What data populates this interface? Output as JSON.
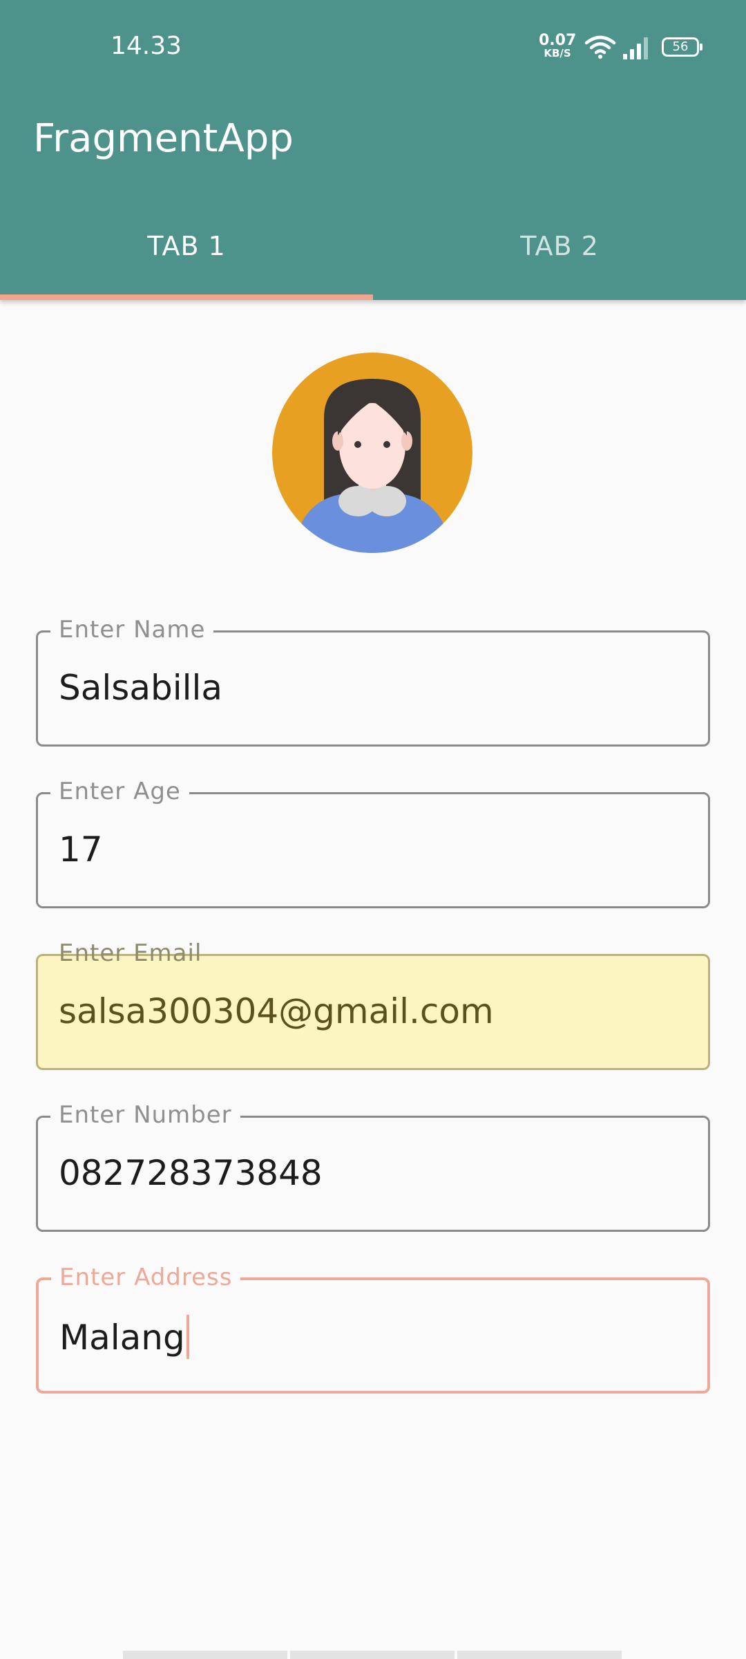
{
  "status_bar": {
    "time": "14.33",
    "net_speed_value": "0.07",
    "net_speed_unit": "KB/S",
    "battery": "56",
    "icons": [
      "wifi-icon",
      "signal-icon",
      "battery-icon"
    ]
  },
  "app_bar": {
    "title": "FragmentApp"
  },
  "tabs": [
    {
      "label": "TAB 1",
      "selected": true
    },
    {
      "label": "TAB 2",
      "selected": false
    }
  ],
  "colors": {
    "app_bar": "#4e928c",
    "tab_indicator": "#f2a48f",
    "focus_accent": "#eea898",
    "autofill_bg": "#fcf5c2",
    "avatar_bg": "#e8a023"
  },
  "form": {
    "fields": [
      {
        "label": "Enter Name",
        "value": "Salsabilla"
      },
      {
        "label": "Enter Age",
        "value": "17"
      },
      {
        "label": "Enter Email",
        "value": "salsa300304@gmail.com",
        "state": "autofilled"
      },
      {
        "label": "Enter Number",
        "value": "082728373848"
      },
      {
        "label": "Enter Address",
        "value": "Malang",
        "state": "focused"
      }
    ]
  }
}
